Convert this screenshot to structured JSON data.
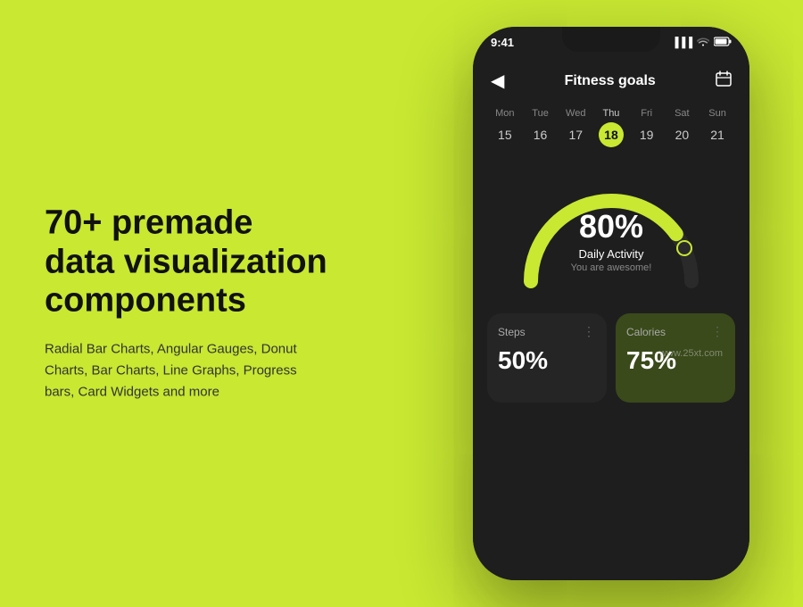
{
  "background": "#c8e832",
  "left": {
    "headline": "70+ premade\ndata visualization\ncomponents",
    "subtext": "Radial Bar Charts, Angular Gauges, Donut Charts, Bar Charts, Line Graphs, Progress bars, Card Widgets and more"
  },
  "phone": {
    "status": {
      "time": "9:41",
      "signal": "▐▐▐",
      "wifi": "wifi",
      "battery": "battery"
    },
    "header": {
      "back": "◀",
      "title": "Fitness goals",
      "icon": "📅"
    },
    "calendar": {
      "days": [
        {
          "name": "Mon",
          "num": "15"
        },
        {
          "name": "Tue",
          "num": "16"
        },
        {
          "name": "Wed",
          "num": "17"
        },
        {
          "name": "Thu",
          "num": "18",
          "active": true
        },
        {
          "name": "Fri",
          "num": "19"
        },
        {
          "name": "Sat",
          "num": "20"
        },
        {
          "name": "Sun",
          "num": "21"
        }
      ]
    },
    "gauge": {
      "percent": "80%",
      "label": "Daily Activity",
      "sublabel": "You are awesome!",
      "value": 80,
      "color": "#c8e832",
      "track_color": "#2a2a2a"
    },
    "cards": [
      {
        "title": "Steps",
        "value": "50%",
        "green": false
      },
      {
        "title": "Calories",
        "value": "75%",
        "green": true
      }
    ],
    "watermark": "www.25xt.com"
  }
}
